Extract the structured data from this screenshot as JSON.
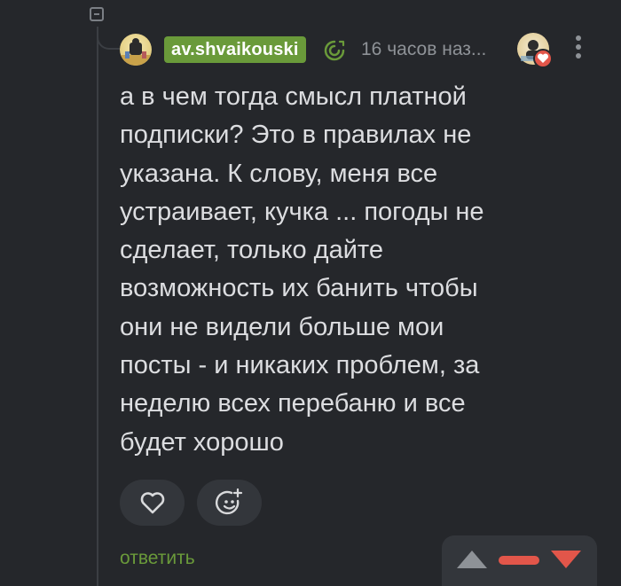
{
  "comment": {
    "author": "av.shvaikouski",
    "timestamp": "16 часов наз...",
    "text": "а в чем тогда смысл платной\nподписки? Это в правилах не\nуказана. К слову, меня все\nустраивает, кучка ... погоды не\nсделает, только дайте\nвозможность их банить чтобы\nони не видели больше мои\nпосты - и никаких проблем, за\nнеделю всех перебаню и все\nбудет хорошо",
    "reply_label": "ответить"
  },
  "icons": {
    "collapse": "collapse-minus-icon",
    "badge": "spiral-badge-icon",
    "more": "more-vertical-icon",
    "like": "heart-icon",
    "react": "emoji-add-icon",
    "vote_up": "triangle-up-icon",
    "vote_down": "triangle-down-icon"
  },
  "colors": {
    "background": "#25272b",
    "username_bg": "#6a9a3a",
    "reply_link": "#6a9a3a",
    "rating_negative": "#e2564a",
    "muted": "#8e9297"
  }
}
